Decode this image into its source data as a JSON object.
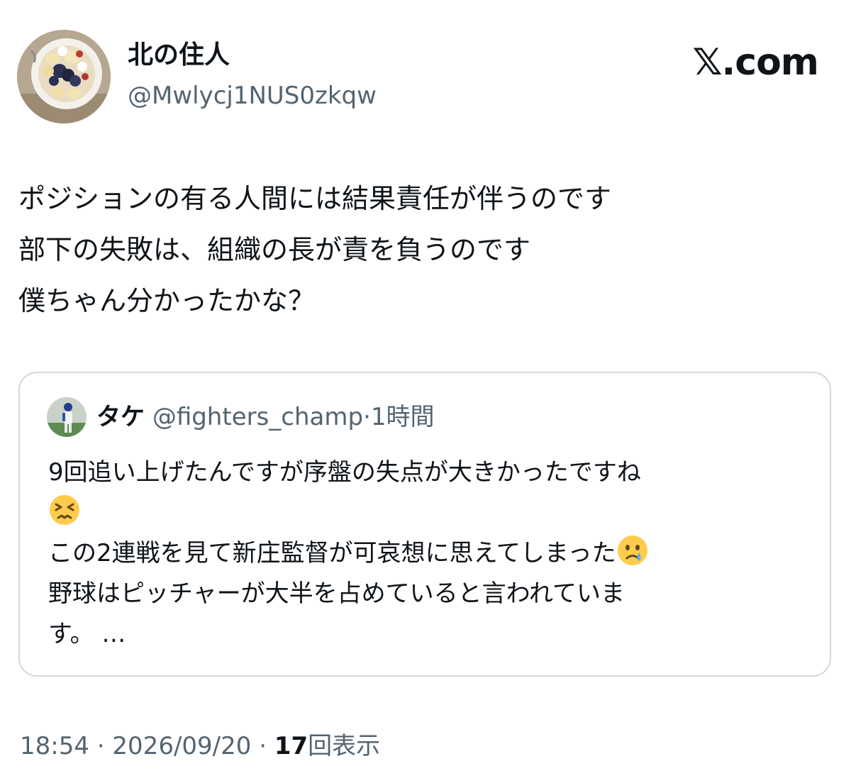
{
  "author": {
    "display_name": "北の住人",
    "handle": "@Mwlycj1NUS0zkqw",
    "avatar": "fruit-bowl-avatar"
  },
  "brand": {
    "label": "𝕏.com"
  },
  "tweet": {
    "lines": [
      "ポジションの有る人間には結果責任が伴うのです",
      "部下の失敗は、組織の長が責を負うのです",
      "僕ちゃん分かったかな？"
    ]
  },
  "quote": {
    "avatar": "baseball-player-avatar",
    "name": "タケ",
    "handle": "@fighters_champ",
    "separator": "·",
    "time": "1時間",
    "lines": [
      "9回追い上げたんですが序盤の失点が大きかったですね",
      "",
      "この2連戦を見て新庄監督が可哀想に思えてしまった",
      "野球はピッチャーが大半を占めていると言われていま",
      "す。 …"
    ],
    "emoji": [
      "persevering-face-emoji",
      "crying-face-emoji"
    ]
  },
  "meta": {
    "time": "18:54",
    "sep1": "·",
    "date": "2026/09/20",
    "sep2": "·",
    "views_count": "17",
    "views_label": "回表示"
  }
}
